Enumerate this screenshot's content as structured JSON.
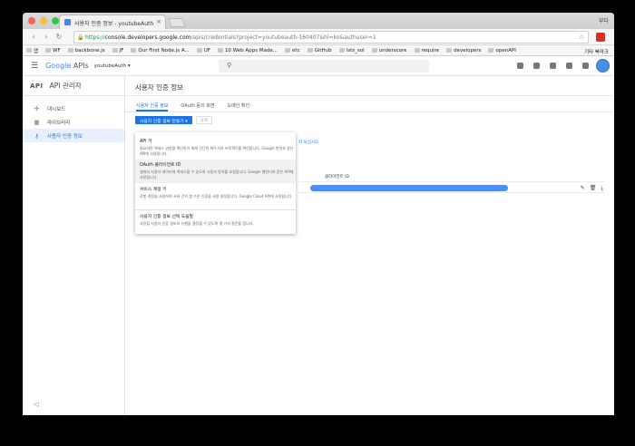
{
  "browser": {
    "tab_title": "사용자 인증 정보 - youtubeAuth",
    "tab_close": "×",
    "profile_name": "부다",
    "url": {
      "scheme": "https://",
      "host": "console.developers.google.com",
      "path": "/apis/credentials?project=youtubeauth-1604​07&hl=ko&authuser=1"
    },
    "nav": {
      "back": "‹",
      "forward": "›",
      "reload": "↻",
      "star": "☆"
    },
    "bookmarks": [
      "앱",
      "WF",
      "backbone.js",
      "JF",
      "Our First Node.js A...",
      "UF",
      "10 Web Apps Made...",
      "etc",
      "GitHub",
      "lsts_sol",
      "underscore",
      "require",
      "developers",
      "openAPI"
    ],
    "other_bookmarks": "기타 북마크"
  },
  "header": {
    "logo_google": "Google",
    "logo_apis": " APIs",
    "project": "youtubeAuth ▾",
    "search_icon": "search-icon"
  },
  "sidebar": {
    "badge": "API",
    "title": "API 관리자",
    "items": [
      {
        "label": "대시보드",
        "icon": "✣"
      },
      {
        "label": "라이브러리",
        "icon": "▦"
      },
      {
        "label": "사용자 인증 정보",
        "icon": "⚷"
      }
    ],
    "collapse": "◁"
  },
  "content": {
    "page_title": "사용자 인증 정보",
    "tabs": [
      "사용자 인증 정보",
      "OAuth 동의 화면",
      "도메인 확인"
    ],
    "create_button": "사용자 인증 정보 만들기 ▾",
    "delete_button": "삭제",
    "menu": [
      {
        "title": "API 키",
        "desc": "필요하면 액세스 권한을 확인하기 위해 간단한 API 키로 프로젝트를 확인합니다. Google 번역과 같은 API에 사용됩니다."
      },
      {
        "title": "OAuth 클라이언트 ID",
        "desc": "앱에서 사용자 데이터에 액세스할 수 있도록 사용자 동의를 요청합니다. Google 캘린더와 같은 API에 사용됩니다."
      },
      {
        "title": "서비스 계정 키",
        "desc": "로봇 계정을 사용하여 서버 간의 앱 수준 인증을 사용 설정합니다. Google Cloud API에 사용됩니다."
      },
      {
        "title": "사용자 인증 정보 선택 도움말",
        "desc": "사용할 사용자 인증 정보의 유형을 결정할 수 있도록 몇 가지 질문을 합니다."
      }
    ],
    "help_link": "지 보십시오.",
    "column_header": "클라이언트 ID",
    "row_icons": [
      "✎",
      "🗑",
      "⤓"
    ]
  },
  "colors": {
    "accent": "#1a73e8",
    "redaction": "#4c8df6",
    "traffic": [
      "#fc615d",
      "#fdbc40",
      "#34c84a"
    ]
  }
}
